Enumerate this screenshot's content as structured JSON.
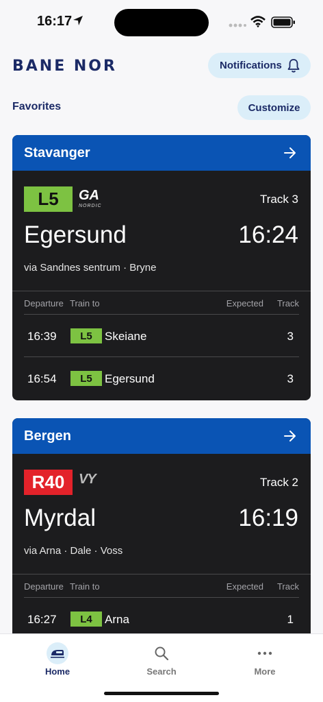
{
  "status": {
    "time": "16:17"
  },
  "header": {
    "logo": "BANE NOR",
    "notifications_label": "Notifications"
  },
  "favorites": {
    "title": "Favorites",
    "customize_label": "Customize"
  },
  "table_headers": {
    "departure": "Departure",
    "train_to": "Train to",
    "expected": "Expected",
    "track": "Track"
  },
  "cards": [
    {
      "station": "Stavanger",
      "line": "L5",
      "line_color": "#7dc242",
      "operator": "GA",
      "operator_sub": "NORDIC",
      "track": "Track 3",
      "destination": "Egersund",
      "time": "16:24",
      "via": "via Sandnes sentrum · Bryne",
      "rows": [
        {
          "time": "16:39",
          "line": "L5",
          "destination": "Skeiane",
          "track": "3"
        },
        {
          "time": "16:54",
          "line": "L5",
          "destination": "Egersund",
          "track": "3"
        }
      ]
    },
    {
      "station": "Bergen",
      "line": "R40",
      "line_color": "#e3222a",
      "operator": "VY",
      "track": "Track 2",
      "destination": "Myrdal",
      "time": "16:19",
      "via": "via Arna · Dale · Voss",
      "rows": [
        {
          "time": "16:27",
          "line": "L4",
          "destination": "Arna",
          "track": "1"
        }
      ]
    }
  ],
  "tabs": [
    {
      "label": "Home",
      "icon": "train-icon",
      "active": true
    },
    {
      "label": "Search",
      "icon": "search-icon",
      "active": false
    },
    {
      "label": "More",
      "icon": "more-icon",
      "active": false
    }
  ],
  "colors": {
    "brand": "#1b2a66",
    "card_header": "#0a54b4",
    "pill": "#dbeef9"
  }
}
